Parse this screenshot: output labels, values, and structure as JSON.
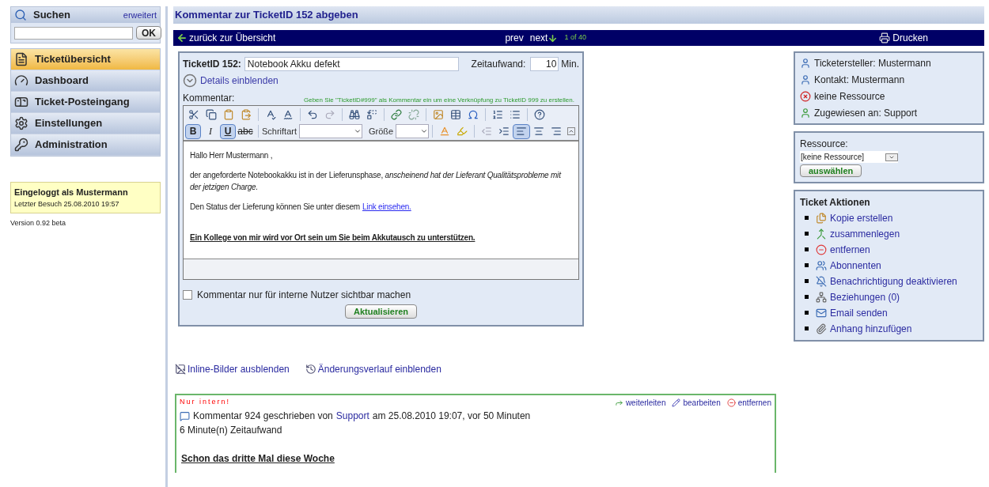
{
  "search": {
    "title": "Suchen",
    "advanced_link": "erweitert",
    "button": "OK"
  },
  "nav": [
    {
      "label": "Ticketübersicht",
      "kind": "tickets",
      "selected": true
    },
    {
      "label": "Dashboard",
      "kind": "dashboard",
      "selected": false
    },
    {
      "label": "Ticket-Posteingang",
      "kind": "inbox",
      "selected": false
    },
    {
      "label": "Einstellungen",
      "kind": "settings",
      "selected": false
    },
    {
      "label": "Administration",
      "kind": "admin",
      "selected": false
    }
  ],
  "login": {
    "title": "Eingeloggt als Mustermann",
    "last_visit": "Letzter Besuch 25.08.2010 19:57"
  },
  "version": "Version 0.92 beta",
  "page_title": "Kommentar zur TicketID 152 abgeben",
  "navbar": {
    "back": "zurück zur Übersicht",
    "prev": "prev",
    "next": "next",
    "counter": "1 of 40",
    "print": "Drucken"
  },
  "form": {
    "ticket_label": "TicketID 152:",
    "ticket_value": "Notebook Akku defekt",
    "time_label": "Zeitaufwand:",
    "time_value": "10",
    "time_unit": "Min.",
    "details_link": "Details einblenden",
    "comment_label": "Kommentar:",
    "hint": "Geben Sie \"TicketID#999\" als Kommentar ein um eine Verknüpfung zu TicketID 999 zu erstellen.",
    "format_buttons": [
      {
        "kind": "bold",
        "label": "B",
        "active": true
      },
      {
        "kind": "italic",
        "label": "I",
        "active": false
      },
      {
        "kind": "underline",
        "label": "U",
        "active": true
      },
      {
        "kind": "strike",
        "label": "abc",
        "active": false
      }
    ],
    "font_label": "Schriftart",
    "size_label": "Größe",
    "alignment": [
      {
        "kind": "left",
        "active": true
      },
      {
        "kind": "center",
        "active": false
      },
      {
        "kind": "right",
        "active": false
      }
    ],
    "paragraphs": [
      {
        "kind": "plain",
        "text": "Hallo Herr Mustermann ,"
      },
      {
        "kind": "plain",
        "text": "der angeforderte Notebookakku ist in der Lieferunsphase, *anscheinend hat der Lieferant Qualitätsprobleme mit der jetzigen Charge.*"
      },
      {
        "kind": "link",
        "text": "Den Status der Lieferung können Sie unter diesem",
        "link": "Link einsehen."
      },
      {
        "kind": "spacer"
      },
      {
        "kind": "emphasis",
        "text": "Ein Kollege von mir wird vor Ort sein um Sie beim Akkutausch zu unterstützen."
      }
    ],
    "internal_checkbox": {
      "label": "Kommentar nur für interne Nutzer sichtbar machen",
      "checked": false
    },
    "submit": "Aktualisieren"
  },
  "info": [
    {
      "kind": "person",
      "text": "Ticketersteller: Mustermann"
    },
    {
      "kind": "person",
      "text": "Kontakt: Mustermann"
    },
    {
      "kind": "none",
      "text": "keine Ressource"
    },
    {
      "kind": "assignee",
      "text": "Zugewiesen an: Support"
    }
  ],
  "resource": {
    "label": "Ressource:",
    "value": "[keine Ressource]",
    "button": "auswählen"
  },
  "actions": {
    "title": "Ticket Aktionen",
    "items": [
      {
        "kind": "copy",
        "label": "Kopie erstellen"
      },
      {
        "kind": "merge",
        "label": "zusammenlegen"
      },
      {
        "kind": "remove",
        "label": "entfernen"
      },
      {
        "kind": "subscribers",
        "label": "Abonnenten"
      },
      {
        "kind": "notify",
        "label": "Benachrichtigung deaktivieren"
      },
      {
        "kind": "relations",
        "label": "Beziehungen (0)"
      },
      {
        "kind": "email",
        "label": "Email senden"
      },
      {
        "kind": "attach",
        "label": "Anhang hinzufügen"
      }
    ]
  },
  "links": [
    {
      "kind": "images",
      "label": "Inline-Bilder ausblenden"
    },
    {
      "kind": "history",
      "label": "Änderungsverlauf einblenden"
    }
  ],
  "comment": {
    "internal_label": "Nur intern!",
    "actions": [
      {
        "kind": "forward",
        "label": "weiterleiten"
      },
      {
        "kind": "edit",
        "label": "bearbeiten"
      },
      {
        "kind": "remove",
        "label": "entfernen"
      }
    ],
    "meta_before": "Kommentar 924 geschrieben von",
    "author": "Support",
    "meta_after": "am 25.08.2010 19:07, vor 50 Minuten",
    "time": "6 Minute(n) Zeitaufwand",
    "body": "Schon das dritte Mal diese Woche"
  }
}
